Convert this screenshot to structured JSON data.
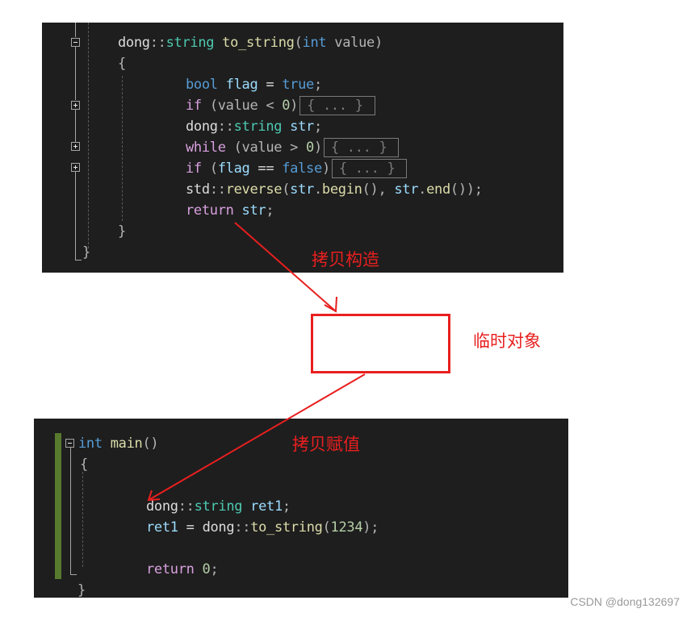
{
  "top_code": {
    "lines": [
      {
        "parts": [
          [
            "plain",
            "dong"
          ],
          [
            "punct",
            "::"
          ],
          [
            "type",
            "string"
          ],
          [
            "plain",
            " "
          ],
          [
            "fn",
            "to_string"
          ],
          [
            "punct",
            "("
          ],
          [
            "kw",
            "int"
          ],
          [
            "plain",
            " "
          ],
          [
            "punct",
            "value"
          ],
          [
            "punct",
            ")"
          ]
        ]
      },
      {
        "parts": [
          [
            "punct",
            "{"
          ]
        ]
      },
      {
        "parts": [
          [
            "kw",
            "bool"
          ],
          [
            "plain",
            " "
          ],
          [
            "var",
            "flag"
          ],
          [
            "plain",
            " = "
          ],
          [
            "kw",
            "true"
          ],
          [
            "punct",
            ";"
          ]
        ]
      },
      {
        "parts": [
          [
            "ctl",
            "if"
          ],
          [
            "plain",
            " "
          ],
          [
            "punct",
            "(value < "
          ],
          [
            "num",
            "0"
          ],
          [
            "punct",
            ")"
          ]
        ],
        "collapsed": "{ ... }"
      },
      {
        "parts": [
          [
            "plain",
            "dong"
          ],
          [
            "punct",
            "::"
          ],
          [
            "type",
            "string"
          ],
          [
            "plain",
            " "
          ],
          [
            "var",
            "str"
          ],
          [
            "punct",
            ";"
          ]
        ]
      },
      {
        "parts": [
          [
            "ctl",
            "while"
          ],
          [
            "plain",
            " "
          ],
          [
            "punct",
            "(value > "
          ],
          [
            "num",
            "0"
          ],
          [
            "punct",
            ")"
          ]
        ],
        "collapsed": "{ ... }"
      },
      {
        "parts": [
          [
            "ctl",
            "if"
          ],
          [
            "plain",
            " "
          ],
          [
            "punct",
            "("
          ],
          [
            "var",
            "flag"
          ],
          [
            "plain",
            " == "
          ],
          [
            "kw",
            "false"
          ],
          [
            "punct",
            ")"
          ]
        ],
        "collapsed": "{ ... }"
      },
      {
        "parts": [
          [
            "plain",
            "std"
          ],
          [
            "punct",
            "::"
          ],
          [
            "fn",
            "reverse"
          ],
          [
            "punct",
            "("
          ],
          [
            "var",
            "str"
          ],
          [
            "punct",
            "."
          ],
          [
            "fn",
            "begin"
          ],
          [
            "punct",
            "(), "
          ],
          [
            "var",
            "str"
          ],
          [
            "punct",
            "."
          ],
          [
            "fn",
            "end"
          ],
          [
            "punct",
            "());"
          ]
        ]
      },
      {
        "parts": [
          [
            "ctl",
            "return"
          ],
          [
            "plain",
            " "
          ],
          [
            "var",
            "str"
          ],
          [
            "punct",
            ";"
          ]
        ]
      },
      {
        "parts": [
          [
            "punct",
            "}"
          ]
        ]
      },
      {
        "parts": [
          [
            "punct",
            "}"
          ]
        ]
      }
    ]
  },
  "bottom_code": {
    "lines": [
      {
        "parts": [
          [
            "kw",
            "int"
          ],
          [
            "plain",
            " "
          ],
          [
            "fn",
            "main"
          ],
          [
            "punct",
            "()"
          ]
        ]
      },
      {
        "parts": [
          [
            "punct",
            "{"
          ]
        ]
      },
      {
        "parts": []
      },
      {
        "parts": [
          [
            "plain",
            "dong"
          ],
          [
            "punct",
            "::"
          ],
          [
            "type",
            "string"
          ],
          [
            "plain",
            " "
          ],
          [
            "var",
            "ret1"
          ],
          [
            "punct",
            ";"
          ]
        ]
      },
      {
        "parts": [
          [
            "var",
            "ret1"
          ],
          [
            "plain",
            " = "
          ],
          [
            "plain",
            "dong"
          ],
          [
            "punct",
            "::"
          ],
          [
            "fn",
            "to_string"
          ],
          [
            "punct",
            "("
          ],
          [
            "num",
            "1234"
          ],
          [
            "punct",
            ");"
          ]
        ]
      },
      {
        "parts": []
      },
      {
        "parts": [
          [
            "ctl",
            "return"
          ],
          [
            "plain",
            " "
          ],
          [
            "num",
            "0"
          ],
          [
            "punct",
            ";"
          ]
        ]
      },
      {
        "parts": [
          [
            "punct",
            "}"
          ]
        ]
      }
    ]
  },
  "annotations": {
    "copy_construct": "拷贝构造",
    "temp_object": "临时对象",
    "copy_assign": "拷贝赋值"
  },
  "colors": {
    "annotation_red": "#e81f1f",
    "editor_bg": "#1e1e1e",
    "change_bar_green": "#577a2e"
  },
  "watermark": "CSDN @dong132697"
}
